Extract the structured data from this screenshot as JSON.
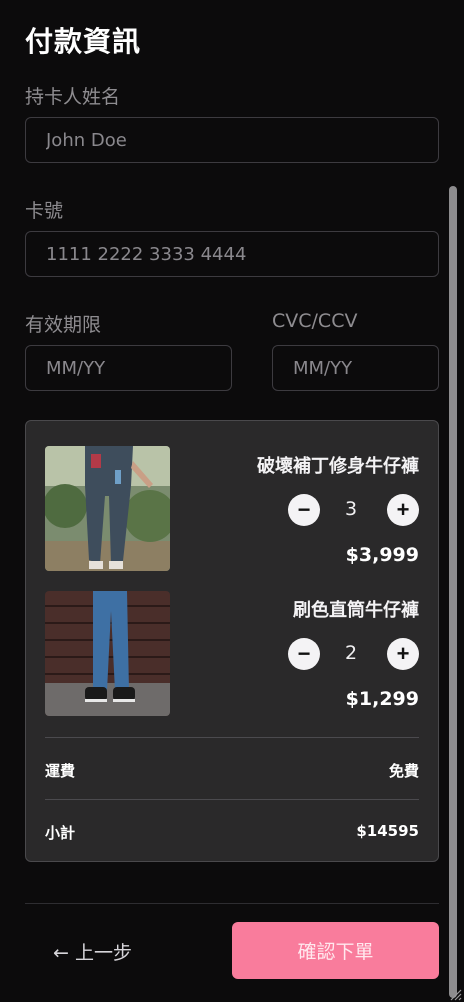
{
  "title": "付款資訊",
  "form": {
    "cardholder_label": "持卡人姓名",
    "cardholder_placeholder": "John Doe",
    "card_number_label": "卡號",
    "card_number_placeholder": "1111 2222 3333 4444",
    "expiry_label": "有效期限",
    "expiry_placeholder": "MM/YY",
    "cvc_label": "CVC/CCV",
    "cvc_placeholder": "MM/YY"
  },
  "cart": {
    "items": [
      {
        "name": "破壞補丁修身牛仔褲",
        "quantity": "3",
        "price": "$3,999"
      },
      {
        "name": "刷色直筒牛仔褲",
        "quantity": "2",
        "price": "$1,299"
      }
    ],
    "shipping_label": "運費",
    "shipping_value": "免費",
    "subtotal_label": "小計",
    "subtotal_value": "$14595"
  },
  "footer": {
    "back_label": "← 上一步",
    "confirm_label": "確認下單"
  },
  "colors": {
    "background": "#0c0b0c",
    "card": "#2a292a",
    "accent": "#f97c9c"
  }
}
